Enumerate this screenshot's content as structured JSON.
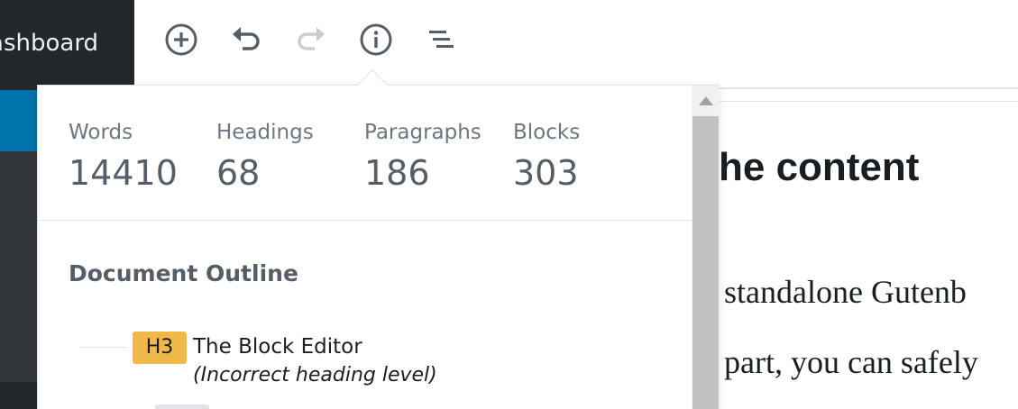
{
  "admin_sidebar": {
    "dashboard_label": "Dashboard"
  },
  "toolbar": {
    "buttons": [
      {
        "name": "add-block-button",
        "icon": "plus-circle-icon",
        "enabled": true
      },
      {
        "name": "undo-button",
        "icon": "undo-icon",
        "enabled": true
      },
      {
        "name": "redo-button",
        "icon": "redo-icon",
        "enabled": false
      },
      {
        "name": "content-structure-button",
        "icon": "info-icon",
        "enabled": true,
        "active": true
      },
      {
        "name": "block-navigation-button",
        "icon": "list-icon",
        "enabled": true
      }
    ]
  },
  "popover": {
    "stats": [
      {
        "label": "Words",
        "value": "14410"
      },
      {
        "label": "Headings",
        "value": "68"
      },
      {
        "label": "Paragraphs",
        "value": "186"
      },
      {
        "label": "Blocks",
        "value": "303"
      }
    ],
    "outline": {
      "title": "Document Outline",
      "items": [
        {
          "level": "H3",
          "text": "The Block Editor",
          "warning": "(Incorrect heading level)"
        }
      ]
    }
  },
  "editor": {
    "heading_fragment": "he content",
    "paragraph_lines": [
      "standalone Gutenb",
      "part, you can safely"
    ]
  },
  "colors": {
    "admin_bg": "#23282d",
    "admin_active": "#0073aa",
    "badge_warning": "#f0b849",
    "icon": "#555d66",
    "icon_disabled": "#c9cdd1"
  }
}
